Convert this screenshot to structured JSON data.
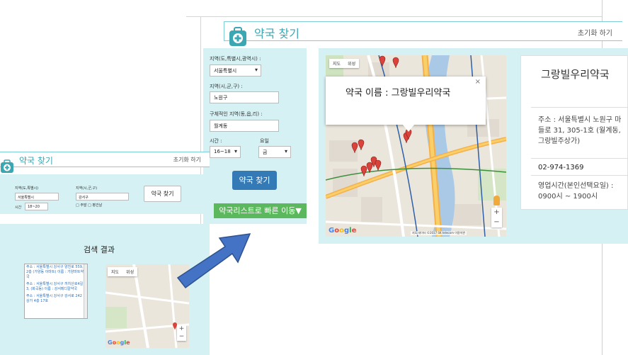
{
  "colors": {
    "accent_teal": "#3aa7b3",
    "panel_bg": "#d5f1f3",
    "primary_btn": "#337ab7",
    "success_btn": "#5cb85c",
    "arrow": "#4472c4",
    "marker": "#d9433b"
  },
  "big_window": {
    "title": "약국 찾기",
    "reset_label": "초기화 하기",
    "icon": "first-aid-kit-icon",
    "form": {
      "region1_label": "지역(도,특별시,광역시) :",
      "region1_value": "서울특별시",
      "region2_label": "지역(시,군,구) :",
      "region2_value": "노원구",
      "region3_label": "구체적인 지역(동,읍,리) :",
      "region3_value": "월계동",
      "time_label": "시간 :",
      "time_value": "16~18",
      "day_label": "요일",
      "day_value": "금",
      "find_button": "약국 찾기",
      "jump_button": "약국리스트로 빠른 이동▼"
    },
    "map": {
      "maptype_map": "지도",
      "maptype_sat": "위성",
      "zoom_in": "+",
      "zoom_out": "−",
      "copyright": "지도 데이터 ©2017 SK telecom  이용약관",
      "infowindow_text": "약국 이름 : 그랑빌우리약국",
      "infowindow_close": "×"
    },
    "info": {
      "name": "그랑빌우리약국",
      "address": "주소 : 서울특별시 노원구 마들로 31, 305-1호 (월계동, 그랑빌주상가)",
      "phone": "02-974-1369",
      "hours": "영업시간(본인선택요일) : 0900시 ~ 1900시"
    }
  },
  "small_window": {
    "title": "약국 찾기",
    "reset_label": "초기화 하기",
    "icon": "first-aid-kit-icon",
    "form": {
      "region1_label": "지역(도,특별시)",
      "region1_value": "서울특별시",
      "region2_label": "지역(시,군,구)",
      "region2_value": "강서구",
      "time_label": "시간",
      "time_value": "18~20",
      "checks": "□ 주말 □ 평건날",
      "find_button": "약국 찾기"
    },
    "results": {
      "heading": "검색 결과",
      "items": [
        "주소 : 서울특별시 강서구 양천로 559, 2층 (가양동 이마트) 이름 : 가양마트약국",
        "주소 : 서울특별시 강서구 까치산로4길 3, (화곡동) 이름 : 강서메디칼약국",
        "주소 : 서울특별시 강서구 강서로 242 상가 4층 17호"
      ]
    },
    "map": {
      "maptype_map": "지도",
      "maptype_sat": "위성",
      "zoom_in": "+",
      "zoom_out": "−"
    }
  }
}
